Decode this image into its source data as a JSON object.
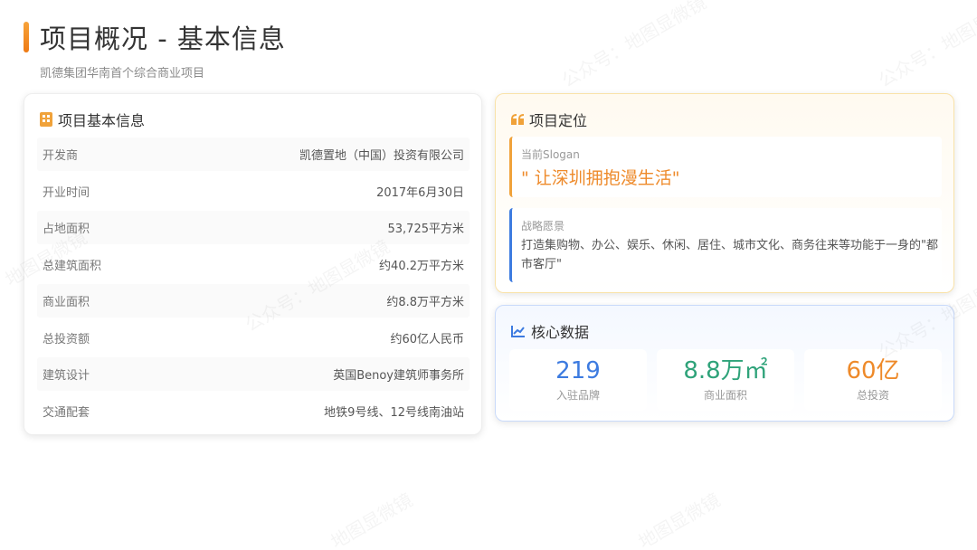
{
  "header": {
    "title": "项目概况 - 基本信息",
    "subtitle": "凯德集团华南首个综合商业项目"
  },
  "basic_info": {
    "heading": "项目基本信息",
    "icon": "building-icon",
    "rows": [
      {
        "key": "开发商",
        "value": "凯德置地（中国）投资有限公司"
      },
      {
        "key": "开业时间",
        "value": "2017年6月30日"
      },
      {
        "key": "占地面积",
        "value": "53,725平方米"
      },
      {
        "key": "总建筑面积",
        "value": "约40.2万平方米"
      },
      {
        "key": "商业面积",
        "value": "约8.8万平方米"
      },
      {
        "key": "总投资额",
        "value": "约60亿人民币"
      },
      {
        "key": "建筑设计",
        "value": "英国Benoy建筑师事务所"
      },
      {
        "key": "交通配套",
        "value": "地铁9号线、12号线南油站"
      }
    ]
  },
  "positioning": {
    "heading": "项目定位",
    "icon": "quote-icon",
    "slogan_label": "当前Slogan",
    "slogan": "\" 让深圳拥抱漫生活\"",
    "vision_label": "战略愿景",
    "vision": "打造集购物、办公、娱乐、休闲、居住、城市文化、商务往来等功能于一身的\"都市客厅\""
  },
  "core_data": {
    "heading": "核心数据",
    "icon": "chart-line-icon",
    "stats": [
      {
        "value": "219",
        "label": "入驻品牌",
        "color": "#3d7be0"
      },
      {
        "value": "8.8万㎡",
        "label": "商业面积",
        "color": "#2fa37a"
      },
      {
        "value": "60亿",
        "label": "总投资",
        "color": "#ee8a2a"
      }
    ]
  },
  "watermark": {
    "text_a": "公众号：地图显微镜",
    "text_b": "地图显微镜"
  },
  "colors": {
    "accent_orange": "#ee8a2a",
    "accent_blue": "#3d7be0",
    "accent_green": "#2fa37a"
  }
}
